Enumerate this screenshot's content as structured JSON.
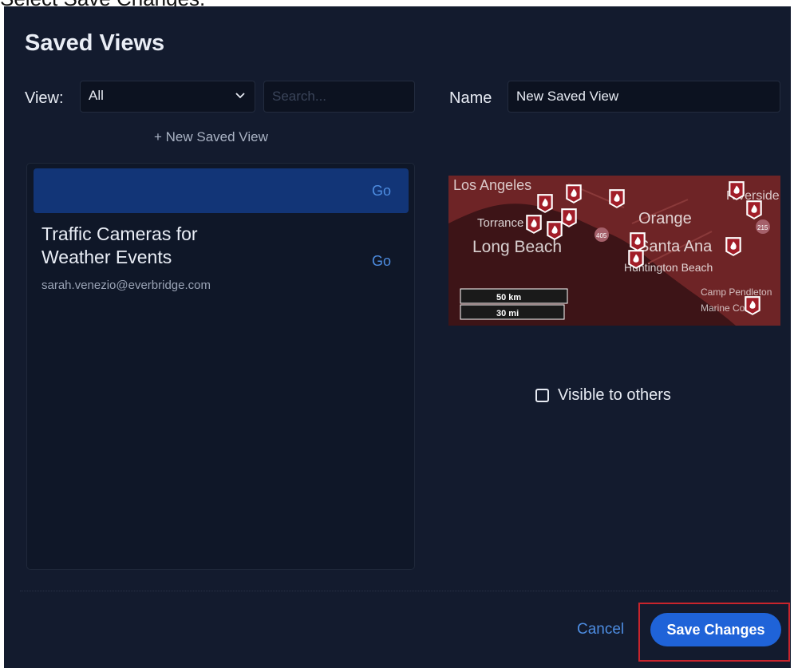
{
  "instruction": "Select Save Changes.",
  "dialog": {
    "title": "Saved Views",
    "view_label": "View:",
    "view_value": "All",
    "search_placeholder": "Search...",
    "new_view_link": "+ New Saved View",
    "list": {
      "selected_go": "Go",
      "items": [
        {
          "name": "Traffic Cameras for Weather Events",
          "go": "Go",
          "owner": "sarah.venezio@everbridge.com"
        }
      ]
    },
    "name_label": "Name",
    "name_value": "New Saved View",
    "map": {
      "labels": [
        "Los Angeles",
        "Torrance",
        "Long Beach",
        "Orange",
        "Santa Ana",
        "Huntington Beach",
        "Camp Pendleton",
        "Marine Corps",
        "Riverside"
      ],
      "shields": [
        "405",
        "215"
      ],
      "scale_km": "50 km",
      "scale_mi": "30 mi"
    },
    "visible_label": "Visible to others",
    "visible_checked": false,
    "cancel_label": "Cancel",
    "save_label": "Save Changes"
  },
  "colors": {
    "dialog_bg": "#131b2e",
    "selected_row": "#123577",
    "accent": "#1f63d8",
    "link": "#4d8ce0",
    "highlight": "#c8242c"
  }
}
